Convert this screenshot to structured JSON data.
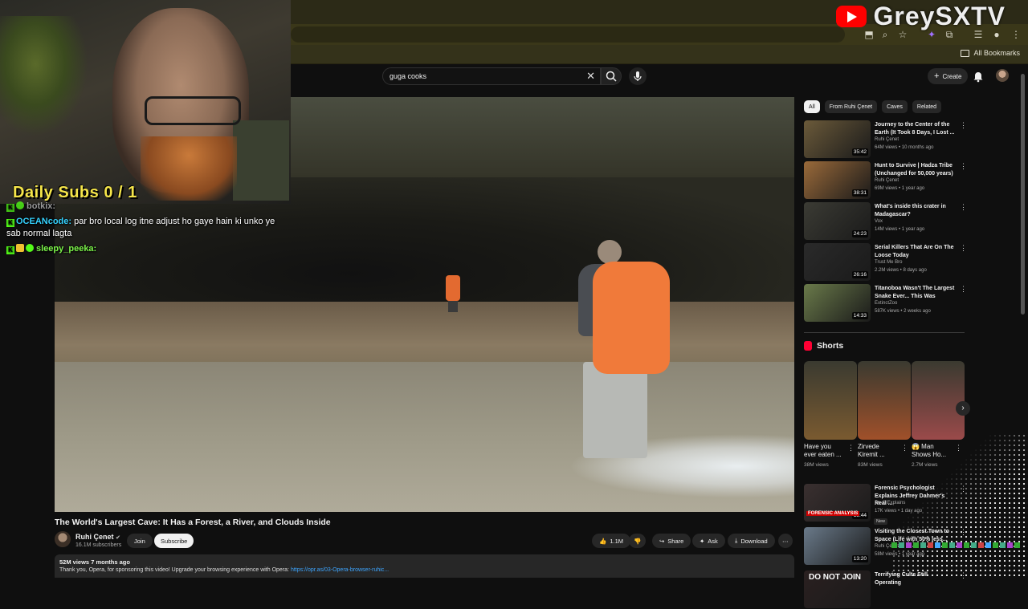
{
  "browser": {
    "bookmarks_label": "All Bookmarks"
  },
  "overlay": {
    "brand_text": "GreySXTV",
    "daily_subs": "Daily Subs  0 / 1",
    "chat": [
      {
        "user": "botkix:",
        "text": ""
      },
      {
        "user": "OCEANcode:",
        "text": "par bro local log itne adjust ho gaye hain ki unko ye sab normal lagta"
      },
      {
        "user": "sleepy_peeka:",
        "text": ""
      }
    ]
  },
  "search": {
    "value": "guga cooks"
  },
  "header": {
    "create_label": "Create"
  },
  "video": {
    "title": "The World's Largest Cave: It Has a Forest, a River, and Clouds Inside",
    "channel": "Ruhi Çenet",
    "subscribers": "16.1M subscribers",
    "join_label": "Join",
    "subscribe_label": "Subscribe",
    "likes": "1.1M",
    "share_label": "Share",
    "ask_label": "Ask",
    "download_label": "Download",
    "description_meta": "52M views  7 months ago",
    "description_line": "Thank you, Opera, for sponsoring this video! Upgrade your browsing experience with Opera:",
    "description_link": "https://opr.as/03-Opera-browser-ruhic..."
  },
  "chips": [
    "All",
    "From Ruhi Çenet",
    "Caves",
    "Related"
  ],
  "recommendations": [
    {
      "title": "Journey to the Center of the Earth (It Took 8 Days, I Lost ...",
      "channel": "Ruhi Çenet",
      "meta": "64M views • 10 months ago",
      "duration": "35:42",
      "color": "#6b5a3a"
    },
    {
      "title": "Hunt to Survive | Hadza Tribe (Unchanged for 50,000 years)",
      "channel": "Ruhi Çenet",
      "meta": "69M views • 1 year ago",
      "duration": "38:31",
      "color": "#9a6a3a"
    },
    {
      "title": "What's inside this crater in Madagascar?",
      "channel": "Vox",
      "meta": "14M views • 1 year ago",
      "duration": "24:23",
      "color": "#3b3b34"
    },
    {
      "title": "Serial Killers That Are On The Loose Today",
      "channel": "Trust Me Bro",
      "meta": "2.2M views • 8 days ago",
      "duration": "26:16",
      "color": "#2a2a2a"
    },
    {
      "title": "Titanoboa Wasn't The Largest Snake Ever... This Was",
      "channel": "ExtinctZoo",
      "meta": "587K views • 2 weeks ago",
      "duration": "14:33",
      "color": "#6a7a4a"
    }
  ],
  "shorts": {
    "heading": "Shorts",
    "items": [
      {
        "title": "Have you ever eaten ...",
        "views": "38M views",
        "color": "#7a5a30"
      },
      {
        "title": "Zirvede Kiremit ...",
        "views": "83M views",
        "color": "#a0502a"
      },
      {
        "title": "😱 Man Shows Ho...",
        "views": "2.7M views",
        "color": "#9a4a4a"
      }
    ]
  },
  "recommendations_lower": [
    {
      "title": "Forensic Psychologist Explains Jeffrey Dahmer's Real ...",
      "channel": "Dr. G Explains",
      "meta": "17K views • 1 day ago",
      "duration": "18:44",
      "badge": "New",
      "color": "#3a3030"
    },
    {
      "title": "Visiting the Closest Town to Space (Life with 50% less...",
      "channel": "Ruhi Çenet",
      "meta": "58M views • 1 year ago",
      "duration": "13:20",
      "color": "#6a7a8a"
    },
    {
      "title": "Terrifying Cults Still Operating",
      "channel": "",
      "meta": "",
      "duration": "",
      "color": "#2a2020"
    }
  ],
  "lower_thumb_texts": {
    "dahmer": "FORENSIC ANALYSIS",
    "cults": "DO NOT JOIN"
  },
  "colors": {
    "accent_red": "#ff0000",
    "link_blue": "#3ea6ff",
    "subs_yellow": "#f5e54a",
    "kick_green": "#53fc18"
  }
}
